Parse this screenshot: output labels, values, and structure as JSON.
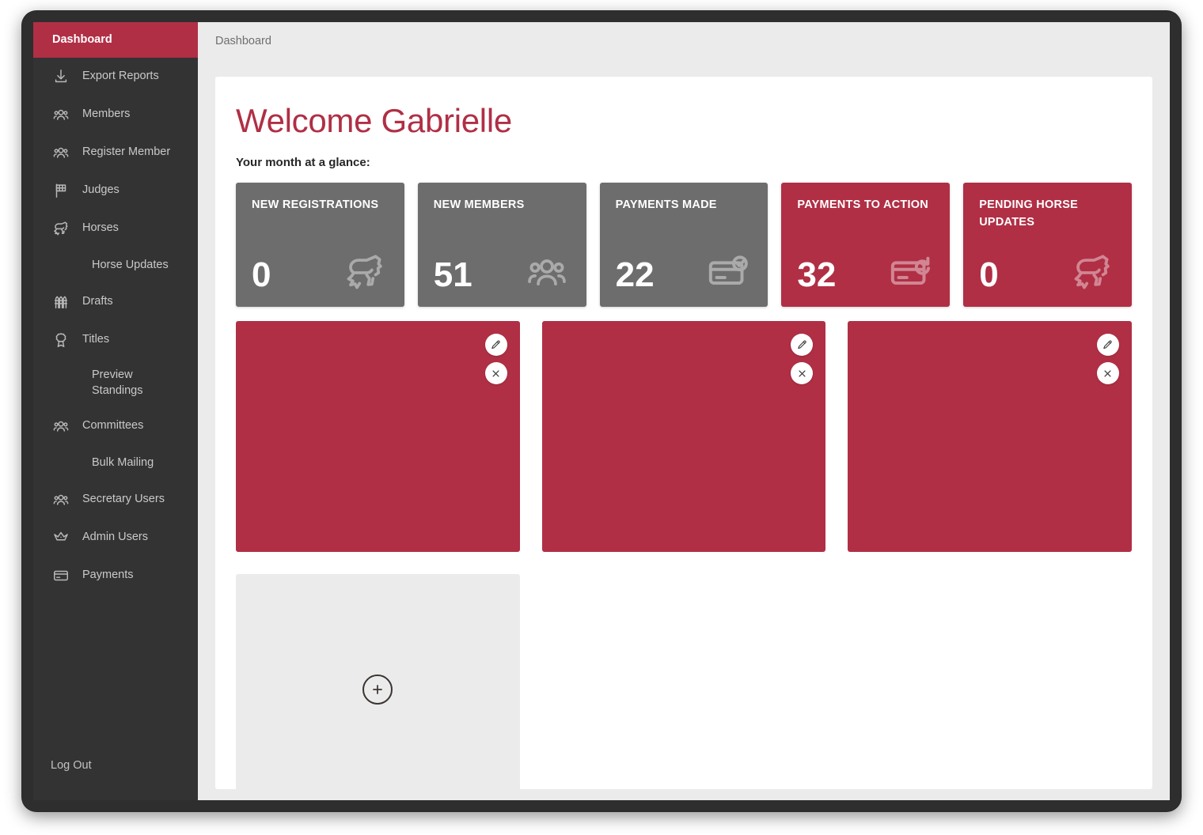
{
  "window": {
    "title": "Dashboard"
  },
  "sidebar": {
    "items": [
      {
        "label": "Dashboard",
        "icon": "none",
        "active": true,
        "sub": false
      },
      {
        "label": "Export Reports",
        "icon": "download-icon",
        "active": false,
        "sub": false
      },
      {
        "label": "Members",
        "icon": "people-icon",
        "active": false,
        "sub": false
      },
      {
        "label": "Register Member",
        "icon": "people-icon",
        "active": false,
        "sub": false
      },
      {
        "label": "Judges",
        "icon": "flag-icon",
        "active": false,
        "sub": false
      },
      {
        "label": "Horses",
        "icon": "horse-icon",
        "active": false,
        "sub": false
      },
      {
        "label": "Horse Updates",
        "icon": "none",
        "active": false,
        "sub": true
      },
      {
        "label": "Drafts",
        "icon": "fence-icon",
        "active": false,
        "sub": false
      },
      {
        "label": "Titles",
        "icon": "rosette-icon",
        "active": false,
        "sub": false
      },
      {
        "label": "Preview\nStandings",
        "icon": "none",
        "active": false,
        "sub": true
      },
      {
        "label": "Committees",
        "icon": "people-icon",
        "active": false,
        "sub": false
      },
      {
        "label": "Bulk Mailing",
        "icon": "none",
        "active": false,
        "sub": true
      },
      {
        "label": "Secretary Users",
        "icon": "people-icon",
        "active": false,
        "sub": false
      },
      {
        "label": "Admin Users",
        "icon": "crown-icon",
        "active": false,
        "sub": false
      },
      {
        "label": "Payments",
        "icon": "card-icon",
        "active": false,
        "sub": false
      }
    ],
    "logout_label": "Log Out"
  },
  "breadcrumb": {
    "label": "Dashboard"
  },
  "main": {
    "welcome_title": "Welcome Gabrielle",
    "glance_label": "Your month at a glance:"
  },
  "stats": [
    {
      "title": "NEW REGISTRATIONS",
      "value": "0",
      "style": "grey",
      "icon": "horse-icon"
    },
    {
      "title": "NEW MEMBERS",
      "value": "51",
      "style": "grey",
      "icon": "people-icon"
    },
    {
      "title": "PAYMENTS MADE",
      "value": "22",
      "style": "grey",
      "icon": "card-check-icon"
    },
    {
      "title": "PAYMENTS TO ACTION",
      "value": "32",
      "style": "red",
      "icon": "card-refresh-icon"
    },
    {
      "title": "PENDING HORSE UPDATES",
      "value": "0",
      "style": "red",
      "icon": "horse-icon"
    }
  ],
  "tiles": [
    {
      "style": "red",
      "edit_icon": "pencil-icon",
      "close_icon": "close-icon"
    },
    {
      "style": "red",
      "edit_icon": "pencil-icon",
      "close_icon": "close-icon"
    },
    {
      "style": "red",
      "edit_icon": "pencil-icon",
      "close_icon": "close-icon"
    },
    {
      "style": "placeholder",
      "add_icon": "plus-circle-icon"
    }
  ],
  "colors": {
    "brand_red": "#b02f45",
    "sidebar_bg": "#333333",
    "stat_grey": "#6d6d6d",
    "page_bg": "#ebebeb",
    "card_bg": "#ffffff",
    "frame": "#2e2e2e"
  }
}
